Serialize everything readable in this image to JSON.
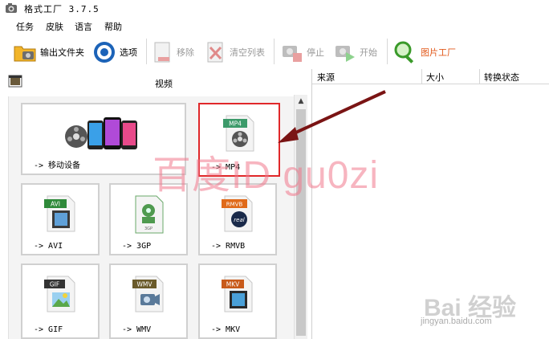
{
  "window": {
    "title": "格式工厂 3.7.5"
  },
  "menu": {
    "items": [
      "任务",
      "皮肤",
      "语言",
      "帮助"
    ]
  },
  "toolbar": {
    "output_folder": "输出文件夹",
    "options": "选项",
    "remove": "移除",
    "clear_list": "清空列表",
    "stop": "停止",
    "start": "开始",
    "picture_factory": "图片工厂"
  },
  "category": {
    "label": "视频"
  },
  "tiles": {
    "mobile": "-> 移动设备",
    "mp4": "-> MP4",
    "avi": "-> AVI",
    "gp3": "-> 3GP",
    "rmvb": "-> RMVB",
    "gif": "-> GIF",
    "wmv": "-> WMV",
    "mkv": "-> MKV"
  },
  "tile_badges": {
    "mp4": "MP4",
    "avi": "AVI",
    "gp3": "3GP",
    "rmvb": "RMVB",
    "gif": "GIF",
    "wmv": "WMV",
    "mkv": "MKV"
  },
  "task_list": {
    "columns": [
      "来源",
      "大小",
      "转换状态"
    ]
  },
  "watermark": {
    "text": "百度ID gu0zi"
  },
  "baidu_mark": {
    "logo": "Bai 经验",
    "url": "jingyan.baidu.com"
  },
  "colors": {
    "highlight": "#e0282a",
    "accent": "#e25a1c",
    "arrow": "#7a1414"
  }
}
